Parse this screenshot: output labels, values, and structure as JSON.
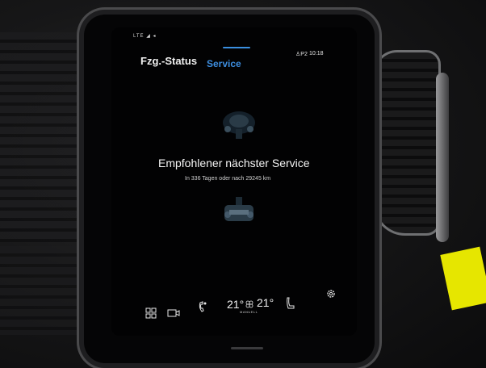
{
  "status_bar": {
    "left_indicators": "LTE ◢ ◂",
    "profile": "♙P2",
    "time": "10:18"
  },
  "tabs": {
    "status_label": "Fzg.-Status",
    "service_label": "Service",
    "active_color": "#3d8ee0"
  },
  "service": {
    "headline": "Empfohlener nächster Service",
    "subline": "In 336 Tagen oder nach 29245 km"
  },
  "climate_bar": {
    "left_temp": "21°",
    "right_temp": "21°",
    "fan_icon": "fan-icon",
    "mode_label": "MANUELL",
    "icons": [
      "apps-grid-icon",
      "camera-icon",
      "phone-icon",
      "fan-icon",
      "seat-heat-icon",
      "settings-icon"
    ]
  }
}
